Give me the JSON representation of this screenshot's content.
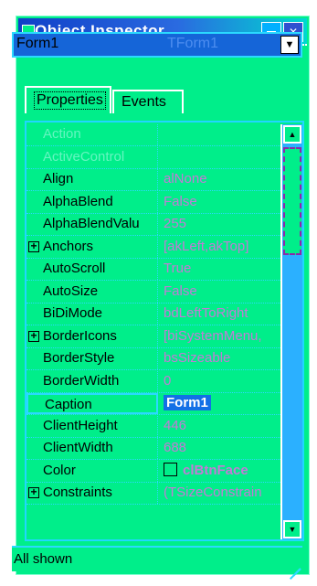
{
  "window": {
    "title": "Object Inspector"
  },
  "component": {
    "name": "Form1",
    "type": "TForm1"
  },
  "tabs": [
    {
      "label": "Properties",
      "active": true
    },
    {
      "label": "Events",
      "active": false
    }
  ],
  "properties": [
    {
      "name": "Action",
      "value": "",
      "disabled": true,
      "expandable": false
    },
    {
      "name": "ActiveControl",
      "value": "",
      "disabled": true,
      "expandable": false
    },
    {
      "name": "Align",
      "value": "alNone",
      "disabled": false,
      "expandable": false
    },
    {
      "name": "AlphaBlend",
      "value": "False",
      "disabled": false,
      "expandable": false
    },
    {
      "name": "AlphaBlendValu",
      "value": "255",
      "disabled": false,
      "expandable": false
    },
    {
      "name": "Anchors",
      "value": "[akLeft,akTop]",
      "disabled": false,
      "expandable": true
    },
    {
      "name": "AutoScroll",
      "value": "True",
      "disabled": false,
      "expandable": false
    },
    {
      "name": "AutoSize",
      "value": "False",
      "disabled": false,
      "expandable": false
    },
    {
      "name": "BiDiMode",
      "value": "bdLeftToRight",
      "disabled": false,
      "expandable": false
    },
    {
      "name": "BorderIcons",
      "value": "[biSystemMenu,",
      "disabled": false,
      "expandable": true
    },
    {
      "name": "BorderStyle",
      "value": "bsSizeable",
      "disabled": false,
      "expandable": false
    },
    {
      "name": "BorderWidth",
      "value": "0",
      "disabled": false,
      "expandable": false
    },
    {
      "name": "Caption",
      "value": "Form1",
      "disabled": false,
      "expandable": false,
      "selected": true
    },
    {
      "name": "ClientHeight",
      "value": "446",
      "disabled": false,
      "expandable": false
    },
    {
      "name": "ClientWidth",
      "value": "688",
      "disabled": false,
      "expandable": false
    },
    {
      "name": "Color",
      "value": "clBtnFace",
      "disabled": false,
      "expandable": false,
      "swatch": true
    },
    {
      "name": "Constraints",
      "value": "(TSizeConstrain",
      "disabled": false,
      "expandable": true
    }
  ],
  "status": {
    "text": "All shown"
  },
  "colors": {
    "background": "#00ee8a",
    "accent": "#2bd9ff",
    "selection": "#1370e6",
    "value_text": "#c37ad6"
  }
}
